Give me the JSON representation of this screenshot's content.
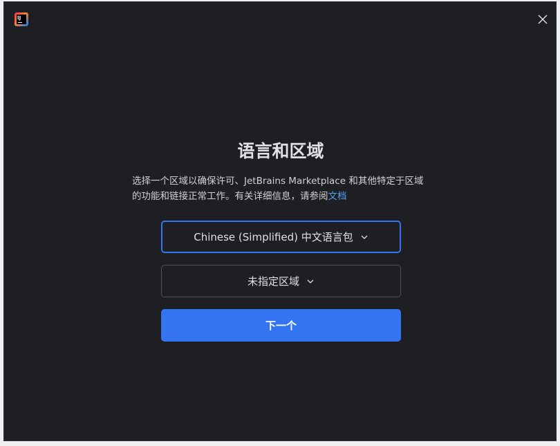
{
  "app": {
    "logo_text": "IJ",
    "logo_icon": "intellij-idea-logo"
  },
  "dialog": {
    "title": "语言和区域",
    "description_text": "选择一个区域以确保许可、JetBrains Marketplace 和其他特定于区域的功能和链接正常工作。有关详细信息，请参阅",
    "description_link": "文档",
    "language_select": {
      "value": "Chinese (Simplified) 中文语言包"
    },
    "region_select": {
      "value": "未指定区域"
    },
    "next_label": "下一个"
  },
  "colors": {
    "background": "#1e1f22",
    "accent": "#3574f0",
    "link": "#589df6",
    "text": "#dfe1e5"
  },
  "icons": {
    "close": "close-icon",
    "chevron": "chevron-down-icon"
  }
}
